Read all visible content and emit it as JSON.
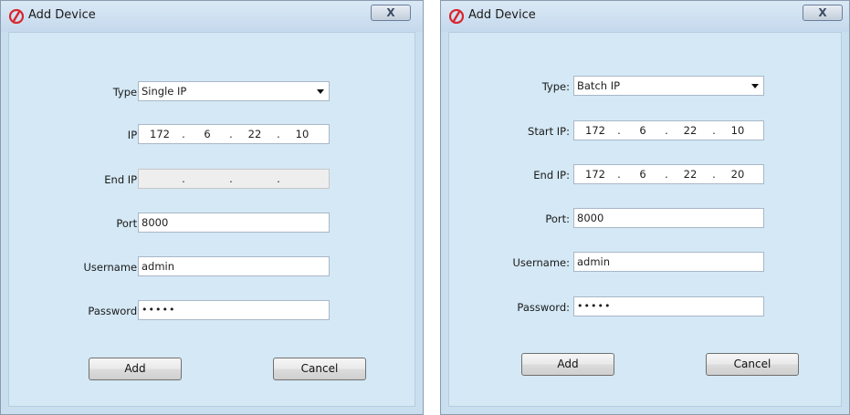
{
  "dialogs": [
    {
      "title": "Add Device",
      "close_label": "X",
      "type_label": "Type:",
      "type_value": "Single IP",
      "ip_label": "IP:",
      "ip_octets": [
        "172",
        "6",
        "22",
        "10"
      ],
      "end_ip_label": "End IP:",
      "end_ip_octets": [
        "",
        "",
        "",
        ""
      ],
      "port_label": "Port:",
      "port_value": "8000",
      "username_label": "Username:",
      "username_value": "admin",
      "password_label": "Password:",
      "password_value": "•••••",
      "add_label": "Add",
      "cancel_label": "Cancel"
    },
    {
      "title": "Add Device",
      "close_label": "X",
      "type_label": "Type:",
      "type_value": "Batch IP",
      "start_ip_label": "Start IP:",
      "start_ip_octets": [
        "172",
        "6",
        "22",
        "10"
      ],
      "end_ip_label": "End IP:",
      "end_ip_octets": [
        "172",
        "6",
        "22",
        "20"
      ],
      "port_label": "Port:",
      "port_value": "8000",
      "username_label": "Username:",
      "username_value": "admin",
      "password_label": "Password:",
      "password_value": "•••••",
      "add_label": "Add",
      "cancel_label": "Cancel"
    }
  ],
  "colors": {
    "dialog_bg": "#d4e8f5",
    "titlebar": "#c4d9ec",
    "icon_red": "#d8262e"
  }
}
